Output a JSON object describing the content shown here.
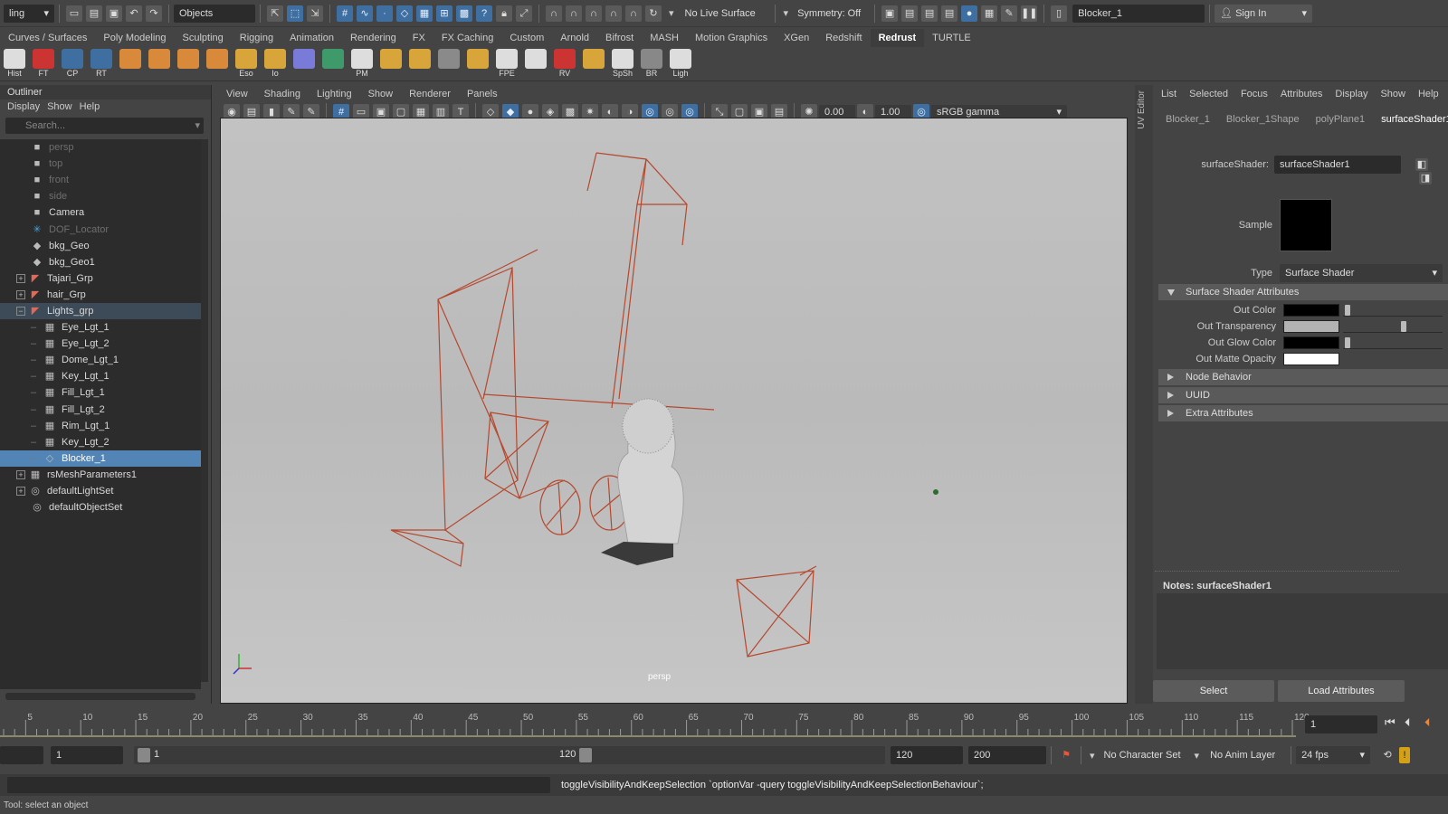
{
  "topbar": {
    "mode": "ling",
    "selection_mode": "Objects",
    "live_surface": "No Live Surface",
    "symmetry": "Symmetry: Off",
    "object_name": "Blocker_1",
    "sign_in": "Sign In"
  },
  "shelf_tabs": [
    "Curves / Surfaces",
    "Poly Modeling",
    "Sculpting",
    "Rigging",
    "Animation",
    "Rendering",
    "FX",
    "FX Caching",
    "Custom",
    "Arnold",
    "Bifrost",
    "MASH",
    "Motion Graphics",
    "XGen",
    "Redshift",
    "Redrust",
    "TURTLE"
  ],
  "active_shelf": "Redrust",
  "shelf_buttons": [
    "Hist",
    "FT",
    "CP",
    "RT",
    "",
    "",
    "",
    "",
    "Eso",
    "Io",
    "",
    "",
    "PM",
    "",
    "",
    "",
    "",
    "FPE",
    "",
    "RV",
    "",
    "SpSh",
    "BR",
    "Ligh"
  ],
  "outliner": {
    "title": "Outliner",
    "menu": [
      "Display",
      "Show",
      "Help"
    ],
    "search_placeholder": "Search...",
    "items": [
      {
        "label": "persp",
        "icon": "camera-icon",
        "dim": true,
        "indent": 0,
        "expander": ""
      },
      {
        "label": "top",
        "icon": "camera-icon",
        "dim": true,
        "indent": 0,
        "expander": ""
      },
      {
        "label": "front",
        "icon": "camera-icon",
        "dim": true,
        "indent": 0,
        "expander": ""
      },
      {
        "label": "side",
        "icon": "camera-icon",
        "dim": true,
        "indent": 0,
        "expander": ""
      },
      {
        "label": "Camera",
        "icon": "camera-icon",
        "dim": false,
        "indent": 0,
        "expander": ""
      },
      {
        "label": "DOF_Locator",
        "icon": "locator-icon",
        "dim": true,
        "indent": 0,
        "expander": ""
      },
      {
        "label": "bkg_Geo",
        "icon": "mesh-icon",
        "dim": false,
        "indent": 0,
        "expander": ""
      },
      {
        "label": "bkg_Geo1",
        "icon": "mesh-icon",
        "dim": false,
        "indent": 0,
        "expander": ""
      },
      {
        "label": "Tajari_Grp",
        "icon": "group-icon",
        "dim": false,
        "indent": 0,
        "expander": "+"
      },
      {
        "label": "hair_Grp",
        "icon": "group-icon",
        "dim": false,
        "indent": 0,
        "expander": "+"
      },
      {
        "label": "Lights_grp",
        "icon": "group-icon",
        "dim": false,
        "indent": 0,
        "expander": "−",
        "hl": true
      },
      {
        "label": "Eye_Lgt_1",
        "icon": "light-icon",
        "dim": false,
        "indent": 1,
        "expander": ""
      },
      {
        "label": "Eye_Lgt_2",
        "icon": "light-icon",
        "dim": false,
        "indent": 1,
        "expander": ""
      },
      {
        "label": "Dome_Lgt_1",
        "icon": "light-icon",
        "dim": false,
        "indent": 1,
        "expander": ""
      },
      {
        "label": "Key_Lgt_1",
        "icon": "light-icon",
        "dim": false,
        "indent": 1,
        "expander": ""
      },
      {
        "label": "Fill_Lgt_1",
        "icon": "light-icon",
        "dim": false,
        "indent": 1,
        "expander": ""
      },
      {
        "label": "Fill_Lgt_2",
        "icon": "light-icon",
        "dim": false,
        "indent": 1,
        "expander": ""
      },
      {
        "label": "Rim_Lgt_1",
        "icon": "light-icon",
        "dim": false,
        "indent": 1,
        "expander": ""
      },
      {
        "label": "Key_Lgt_2",
        "icon": "light-icon",
        "dim": false,
        "indent": 1,
        "expander": ""
      },
      {
        "label": "Blocker_1",
        "icon": "blocker-icon",
        "dim": false,
        "indent": 1,
        "expander": "",
        "sel": true
      },
      {
        "label": "rsMeshParameters1",
        "icon": "light-icon",
        "dim": false,
        "indent": 0,
        "expander": "+"
      },
      {
        "label": "defaultLightSet",
        "icon": "set-icon",
        "dim": false,
        "indent": 0,
        "expander": "+"
      },
      {
        "label": "defaultObjectSet",
        "icon": "set-icon",
        "dim": false,
        "indent": 0,
        "expander": ""
      }
    ]
  },
  "viewport": {
    "menu": [
      "View",
      "Shading",
      "Lighting",
      "Show",
      "Renderer",
      "Panels"
    ],
    "value_a": "0.00",
    "value_b": "1.00",
    "color_space": "sRGB gamma",
    "camera_label": "persp"
  },
  "uv_editor_label": "UV Editor",
  "attribute_editor": {
    "menu": [
      "List",
      "Selected",
      "Focus",
      "Attributes",
      "Display",
      "Show",
      "Help"
    ],
    "tabs": [
      "Blocker_1",
      "Blocker_1Shape",
      "polyPlane1",
      "surfaceShader1"
    ],
    "active_tab": "surfaceShader1",
    "shader_label": "surfaceShader:",
    "shader_value": "surfaceShader1",
    "sample_label": "Sample",
    "type_label": "Type",
    "type_value": "Surface Shader",
    "section_main": "Surface Shader Attributes",
    "attributes": [
      {
        "label": "Out Color",
        "color": "#000000",
        "slider": 0.02
      },
      {
        "label": "Out Transparency",
        "color": "#b3b3b3",
        "slider": 0.62
      },
      {
        "label": "Out Glow Color",
        "color": "#000000",
        "slider": 0.02
      },
      {
        "label": "Out Matte Opacity",
        "color": "#ffffff",
        "slider": null
      }
    ],
    "sections_collapsed": [
      "Node Behavior",
      "UUID",
      "Extra Attributes"
    ],
    "notes_label": "Notes:  surfaceShader1",
    "select_button": "Select",
    "load_button": "Load Attributes"
  },
  "timeline": {
    "ticks": [
      "5",
      "10",
      "15",
      "20",
      "25",
      "30",
      "35",
      "40",
      "45",
      "50",
      "55",
      "60",
      "65",
      "70",
      "75",
      "80",
      "85",
      "90",
      "95",
      "100",
      "105",
      "110",
      "115",
      "120"
    ],
    "current_frame": "1"
  },
  "range": {
    "start": "1",
    "playback_start": "1",
    "playback_end_marker": "120",
    "end": "120",
    "anim_end": "200",
    "character_set": "No Character Set",
    "anim_layer": "No Anim Layer",
    "fps": "24 fps"
  },
  "command_line": "toggleVisibilityAndKeepSelection `optionVar -query toggleVisibilityAndKeepSelectionBehaviour`;",
  "help_line": "Tool: select an object",
  "colors": {
    "light_wire": "#b5482e",
    "selection": "#5285b5"
  }
}
